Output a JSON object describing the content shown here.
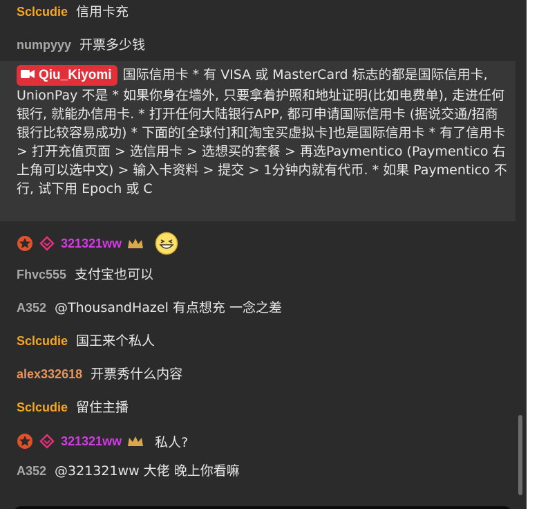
{
  "messages": [
    {
      "user": "Sclcudie",
      "text": "信用卡充"
    },
    {
      "user": "numpyyy",
      "text": "开票多少钱"
    }
  ],
  "highlight": {
    "user": "Qiu_Kiyomi",
    "text": "国际信用卡 * 有 VISA 或 MasterCard 标志的都是国际信用卡, UnionPay 不是 * 如果你身在墙外, 只要拿着护照和地址证明(比如电费单), 走进任何银行, 就能办信用卡. * 打开任何大陆银行APP, 都可申请国际信用卡 (据说交通/招商银行比较容易成功) * 下面的[全球付]和[淘宝买虚拟卡]也是国际信用卡 * 有了信用卡 > 打开充值页面 > 选信用卡 > 选想买的套餐 > 再选Paymentico (Paymentico 右上角可以选中文) > 输入卡资料 > 提交 > 1分钟内就有代币. * 如果 Paymentico 不行, 试下用 Epoch 或 C",
    "accent": "#e0303a"
  },
  "vip1": {
    "user": "321321ww",
    "text": ""
  },
  "messages2": [
    {
      "user": "Fhvc555",
      "text": "支付宝也可以"
    },
    {
      "user": "A352",
      "text": "@ThousandHazel  有点想充 一念之差"
    },
    {
      "user": "Sclcudie",
      "text": "国王来个私人"
    },
    {
      "user": "alex332618",
      "text": "开票秀什么内容"
    },
    {
      "user": "Sclcudie",
      "text": "留住主播"
    }
  ],
  "vip2": {
    "user": "321321ww",
    "text": "私人?"
  },
  "messages3": [
    {
      "user": "A352",
      "text": "@321321ww  大佬 晚上你看嘛"
    }
  ],
  "colors": {
    "orange": "#f5a623",
    "gray": "#a9a9a9",
    "peach": "#e8955a",
    "purple": "#d43ae8",
    "background": "#2b2b2b"
  },
  "icons": [
    "camera-icon",
    "star-badge-icon",
    "diamond-badge-icon",
    "crown-icon",
    "laughing-emoji-icon"
  ]
}
